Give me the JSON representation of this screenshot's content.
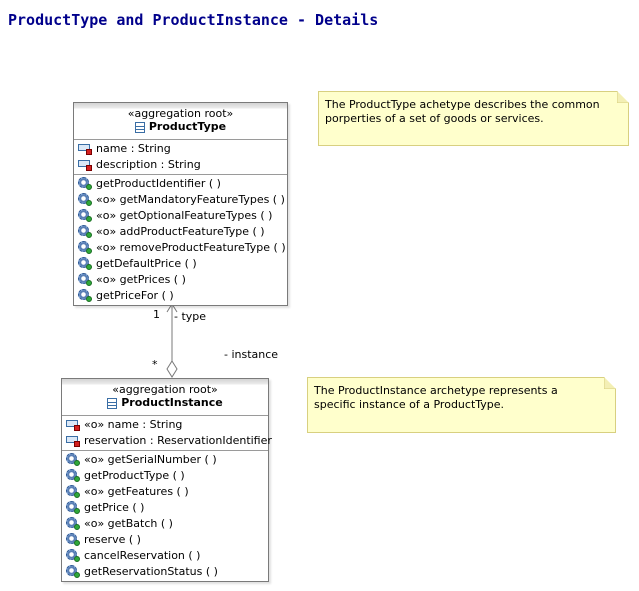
{
  "title": "ProductType and ProductInstance - Details",
  "classes": [
    {
      "stereotype": "«aggregation root»",
      "name": "ProductType",
      "attributes": [
        "name : String",
        "description : String"
      ],
      "operations": [
        "getProductIdentifier ( )",
        "«o» getMandatoryFeatureTypes ( )",
        "«o» getOptionalFeatureTypes ( )",
        "«o» addProductFeatureType ( )",
        "«o» removeProductFeatureType ( )",
        "getDefaultPrice ( )",
        "«o» getPrices ( )",
        "getPriceFor ( )"
      ]
    },
    {
      "stereotype": "«aggregation root»",
      "name": "ProductInstance",
      "attributes": [
        "«o» name : String",
        "reservation : ReservationIdentifier"
      ],
      "operations": [
        "«o» getSerialNumber ( )",
        "getProductType ( )",
        "«o» getFeatures ( )",
        "getPrice ( )",
        "«o» getBatch ( )",
        "reserve ( )",
        "cancelReservation ( )",
        "getReservationStatus ( )"
      ]
    }
  ],
  "notes": [
    "The ProductType achetype describes the common porperties of a set of goods or services.",
    "The ProductInstance archetype represents a specific instance of a ProductType."
  ],
  "association": {
    "multiplicity_type_end": "1",
    "role_type_end": "- type",
    "multiplicity_instance_end": "*",
    "role_instance_end": "- instance"
  },
  "colors": {
    "title": "#00008b",
    "note_fill": "#ffffcc",
    "class_border": "#7a7a7a"
  },
  "icons": {
    "class": "class-icon",
    "attribute": "private-attribute-icon",
    "operation": "public-operation-icon"
  }
}
